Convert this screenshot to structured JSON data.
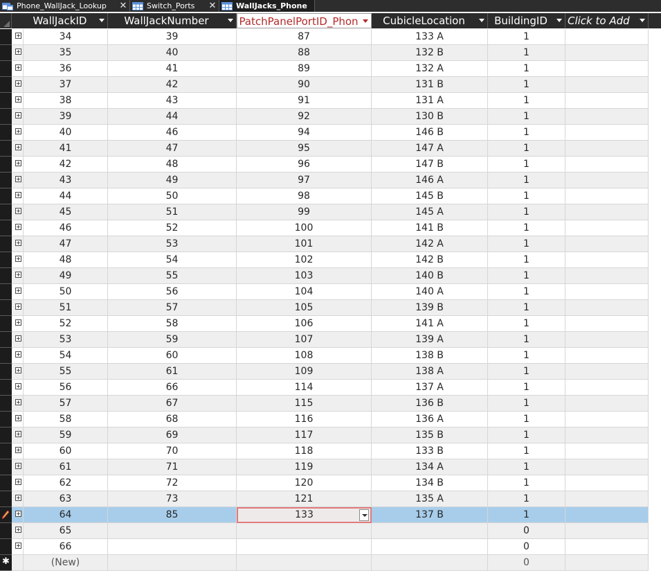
{
  "tabs": [
    {
      "label": "Phone_WallJack_Lookup",
      "icon": "query-icon",
      "active": false
    },
    {
      "label": "Switch_Ports",
      "icon": "table-icon",
      "active": false
    },
    {
      "label": "WallJacks_Phone",
      "icon": "table-icon",
      "active": true
    }
  ],
  "tab_close_glyph": "✕",
  "columns": [
    {
      "label": "WallJackID"
    },
    {
      "label": "WallJackNumber"
    },
    {
      "label": "PatchPanelPortID_Phon"
    },
    {
      "label": "CubicleLocation"
    },
    {
      "label": "BuildingID"
    },
    {
      "label": "Click to Add"
    }
  ],
  "rows": [
    {
      "id": "34",
      "num": "39",
      "port": "87",
      "loc": "133 A",
      "bld": "1"
    },
    {
      "id": "35",
      "num": "40",
      "port": "88",
      "loc": "132 B",
      "bld": "1"
    },
    {
      "id": "36",
      "num": "41",
      "port": "89",
      "loc": "132 A",
      "bld": "1"
    },
    {
      "id": "37",
      "num": "42",
      "port": "90",
      "loc": "131 B",
      "bld": "1"
    },
    {
      "id": "38",
      "num": "43",
      "port": "91",
      "loc": "131 A",
      "bld": "1"
    },
    {
      "id": "39",
      "num": "44",
      "port": "92",
      "loc": "130 B",
      "bld": "1"
    },
    {
      "id": "40",
      "num": "46",
      "port": "94",
      "loc": "146 B",
      "bld": "1"
    },
    {
      "id": "41",
      "num": "47",
      "port": "95",
      "loc": "147 A",
      "bld": "1"
    },
    {
      "id": "42",
      "num": "48",
      "port": "96",
      "loc": "147 B",
      "bld": "1"
    },
    {
      "id": "43",
      "num": "49",
      "port": "97",
      "loc": "146 A",
      "bld": "1"
    },
    {
      "id": "44",
      "num": "50",
      "port": "98",
      "loc": "145 B",
      "bld": "1"
    },
    {
      "id": "45",
      "num": "51",
      "port": "99",
      "loc": "145 A",
      "bld": "1"
    },
    {
      "id": "46",
      "num": "52",
      "port": "100",
      "loc": "141 B",
      "bld": "1"
    },
    {
      "id": "47",
      "num": "53",
      "port": "101",
      "loc": "142 A",
      "bld": "1"
    },
    {
      "id": "48",
      "num": "54",
      "port": "102",
      "loc": "142 B",
      "bld": "1"
    },
    {
      "id": "49",
      "num": "55",
      "port": "103",
      "loc": "140 B",
      "bld": "1"
    },
    {
      "id": "50",
      "num": "56",
      "port": "104",
      "loc": "140 A",
      "bld": "1"
    },
    {
      "id": "51",
      "num": "57",
      "port": "105",
      "loc": "139 B",
      "bld": "1"
    },
    {
      "id": "52",
      "num": "58",
      "port": "106",
      "loc": "141 A",
      "bld": "1"
    },
    {
      "id": "53",
      "num": "59",
      "port": "107",
      "loc": "139 A",
      "bld": "1"
    },
    {
      "id": "54",
      "num": "60",
      "port": "108",
      "loc": "138 B",
      "bld": "1"
    },
    {
      "id": "55",
      "num": "61",
      "port": "109",
      "loc": "138 A",
      "bld": "1"
    },
    {
      "id": "56",
      "num": "66",
      "port": "114",
      "loc": "137 A",
      "bld": "1"
    },
    {
      "id": "57",
      "num": "67",
      "port": "115",
      "loc": "136 B",
      "bld": "1"
    },
    {
      "id": "58",
      "num": "68",
      "port": "116",
      "loc": "136 A",
      "bld": "1"
    },
    {
      "id": "59",
      "num": "69",
      "port": "117",
      "loc": "135 B",
      "bld": "1"
    },
    {
      "id": "60",
      "num": "70",
      "port": "118",
      "loc": "133 B",
      "bld": "1"
    },
    {
      "id": "61",
      "num": "71",
      "port": "119",
      "loc": "134 A",
      "bld": "1"
    },
    {
      "id": "62",
      "num": "72",
      "port": "120",
      "loc": "134 B",
      "bld": "1"
    },
    {
      "id": "63",
      "num": "73",
      "port": "121",
      "loc": "135 A",
      "bld": "1"
    },
    {
      "id": "64",
      "num": "85",
      "port": "133",
      "loc": "137 B",
      "bld": "1",
      "current": true,
      "editing": true
    },
    {
      "id": "65",
      "num": "",
      "port": "",
      "loc": "",
      "bld": "0"
    },
    {
      "id": "66",
      "num": "",
      "port": "",
      "loc": "",
      "bld": "0"
    },
    {
      "id": "(New)",
      "num": "",
      "port": "",
      "loc": "",
      "bld": "0",
      "new": true
    }
  ],
  "colors": {
    "selected_row": "#a7cdeb",
    "selected_header_text": "#b32a2a",
    "active_cell_border": "#e07b7b"
  }
}
